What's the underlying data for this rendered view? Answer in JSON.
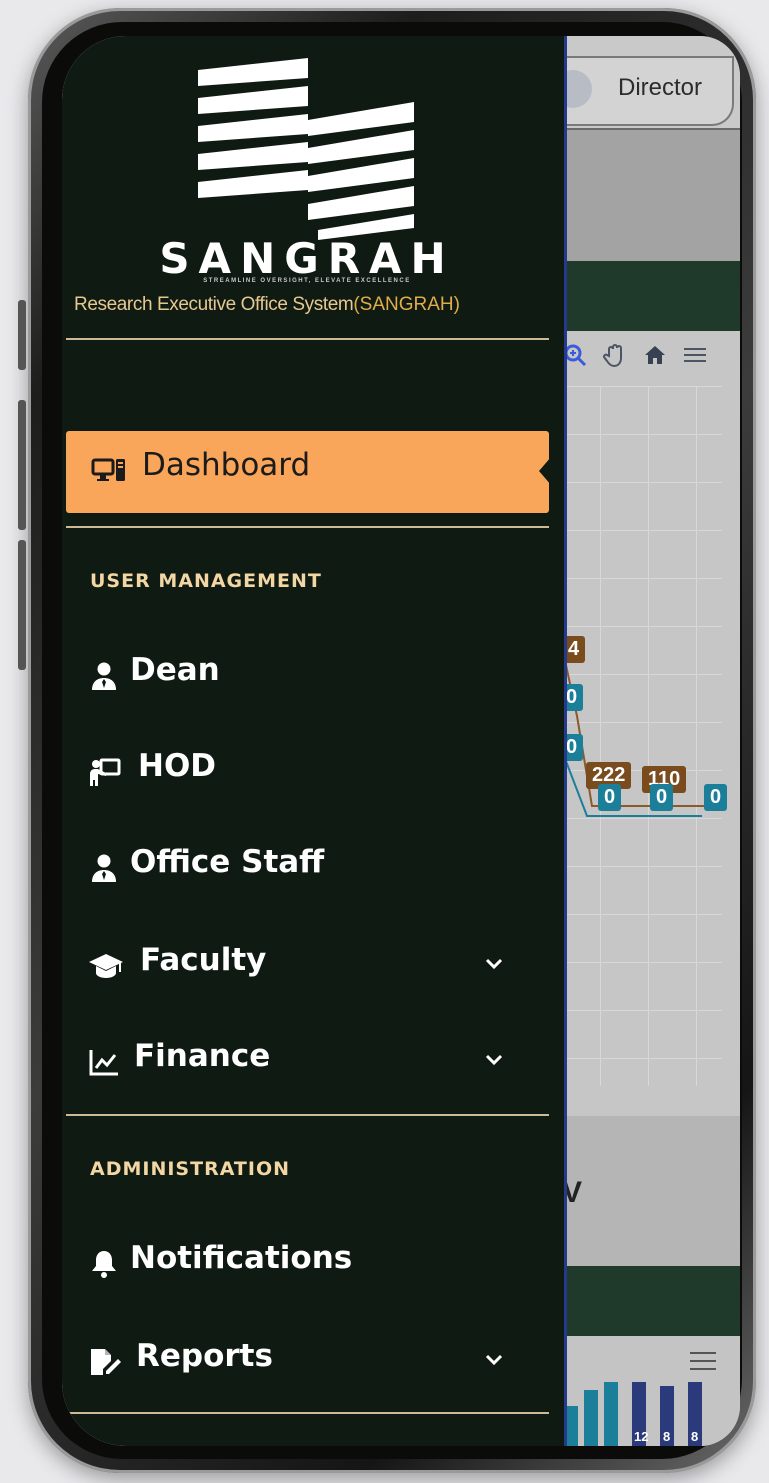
{
  "app": {
    "brand_name": "SANGRAH",
    "tagline": "STREAMLINE OVERSIGHT, ELEVATE EXCELLENCE",
    "subtitle_main": "Research Executive Office System",
    "subtitle_acronym": "(SANGRAH)"
  },
  "colors": {
    "sidebar_bg": "#0f1a12",
    "active_bg": "#f9a65a",
    "section_title": "#f2d6a4",
    "divider": "#cdb996",
    "accent_gold": "#e1ad4a"
  },
  "sidebar": {
    "active_item": {
      "label": "Dashboard",
      "icon": "desktop-icon"
    },
    "sections": [
      {
        "title": "USER MANAGEMENT",
        "items": [
          {
            "label": "Dean",
            "icon": "user-tie-icon",
            "has_submenu": false
          },
          {
            "label": "HOD",
            "icon": "chalkboard-teacher-icon",
            "has_submenu": false
          },
          {
            "label": "Office Staff",
            "icon": "user-tie-icon",
            "has_submenu": false
          },
          {
            "label": "Faculty",
            "icon": "graduation-cap-icon",
            "has_submenu": true
          },
          {
            "label": "Finance",
            "icon": "chart-line-icon",
            "has_submenu": true
          }
        ]
      },
      {
        "title": "ADMINISTRATION",
        "items": [
          {
            "label": "Notifications",
            "icon": "bell-icon",
            "has_submenu": false
          },
          {
            "label": "Reports",
            "icon": "file-signature-icon",
            "has_submenu": true
          }
        ]
      }
    ]
  },
  "background_app": {
    "user_role": "Director",
    "toolbar_icons": [
      "zoom-in-icon",
      "pan-hand-icon",
      "home-icon",
      "menu-icon"
    ],
    "chart_labels": [
      "4",
      "0",
      "0",
      "222",
      "110",
      "0",
      "0",
      "0"
    ],
    "heading_fragment": "V",
    "bottom_labels": [
      "12",
      "8",
      "8"
    ]
  }
}
